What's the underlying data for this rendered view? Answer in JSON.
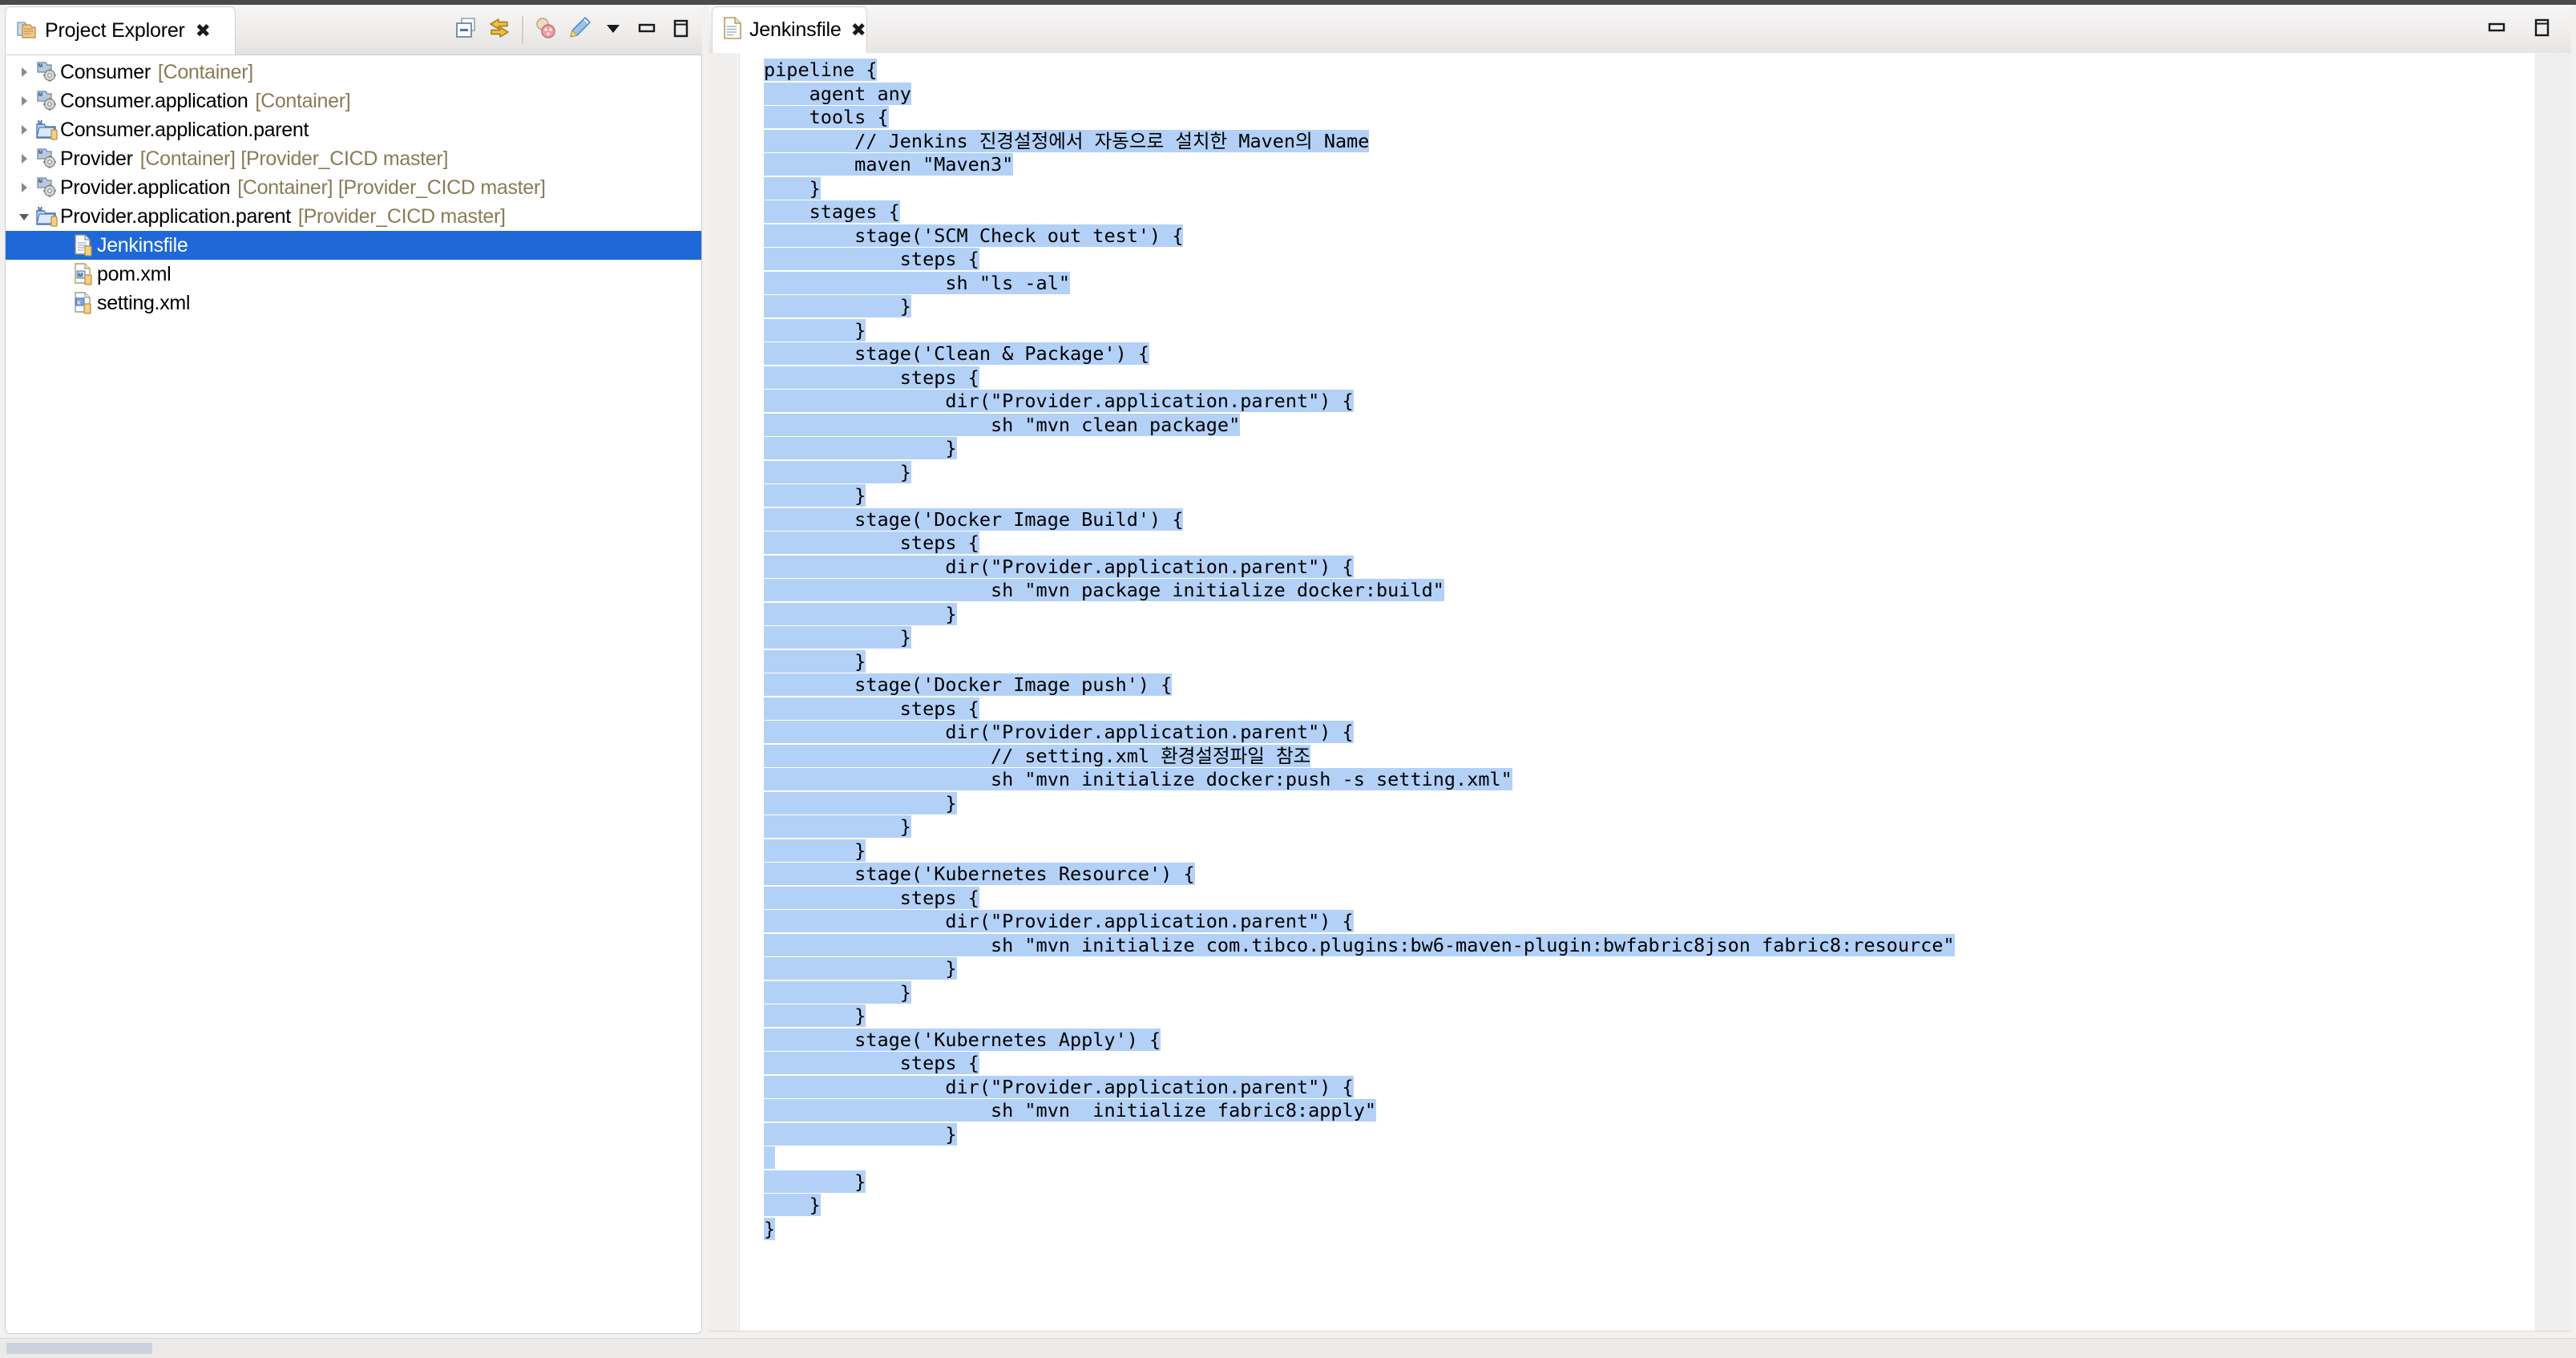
{
  "left_view": {
    "tab": {
      "title": "Project Explorer",
      "close_glyph": "✖",
      "icon": "project-explorer-icon"
    },
    "toolbar": [
      {
        "name": "collapse-all-button",
        "tooltip": "Collapse All"
      },
      {
        "name": "link-with-editor-button",
        "tooltip": "Link with Editor"
      },
      {
        "name": "focus-on-active-task-button",
        "tooltip": "Focus on Active Task"
      },
      {
        "name": "edit-task-button",
        "tooltip": "Edit Task"
      },
      {
        "name": "view-menu-button",
        "tooltip": "View Menu"
      },
      {
        "name": "minimize-button",
        "tooltip": "Minimize"
      },
      {
        "name": "maximize-button",
        "tooltip": "Maximize"
      }
    ],
    "tree": [
      {
        "indent": 1,
        "expander": "collapsed",
        "icon": "maven-project-icon",
        "label": "Consumer",
        "meta": "[Container]",
        "selected": false
      },
      {
        "indent": 1,
        "expander": "collapsed",
        "icon": "maven-project-icon",
        "label": "Consumer.application",
        "meta": "[Container]",
        "selected": false
      },
      {
        "indent": 1,
        "expander": "collapsed",
        "icon": "maven-folder-icon",
        "label": "Consumer.application.parent",
        "meta": "",
        "selected": false
      },
      {
        "indent": 1,
        "expander": "collapsed",
        "icon": "maven-project-icon",
        "label": "Provider",
        "meta": "[Container] [Provider_CICD master]",
        "selected": false
      },
      {
        "indent": 1,
        "expander": "collapsed",
        "icon": "maven-project-icon",
        "label": "Provider.application",
        "meta": "[Container] [Provider_CICD master]",
        "selected": false
      },
      {
        "indent": 1,
        "expander": "expanded",
        "icon": "maven-folder-icon",
        "label": "Provider.application.parent",
        "meta": "[Provider_CICD master]",
        "selected": false
      },
      {
        "indent": 2,
        "expander": "none",
        "icon": "file-text-icon",
        "label": "Jenkinsfile",
        "meta": "",
        "selected": true
      },
      {
        "indent": 2,
        "expander": "none",
        "icon": "pom-xml-icon",
        "label": "pom.xml",
        "meta": "",
        "selected": false
      },
      {
        "indent": 2,
        "expander": "none",
        "icon": "xml-file-icon",
        "label": "setting.xml",
        "meta": "",
        "selected": false
      }
    ]
  },
  "editor": {
    "tab": {
      "title": "Jenkinsfile",
      "close_glyph": "✖",
      "icon": "file-text-icon"
    },
    "window_buttons": [
      {
        "name": "minimize-button",
        "tooltip": "Minimize"
      },
      {
        "name": "maximize-button",
        "tooltip": "Maximize"
      }
    ],
    "selection_color": "#b3d1f7",
    "code": "pipeline {\n    agent any\n    tools {\n        // Jenkins 진경설정에서 자동으로 설치한 Maven의 Name\n        maven \"Maven3\"\n    }\n    stages {\n        stage('SCM Check out test') {\n            steps {\n                sh \"ls -al\"\n            }\n        }\n        stage('Clean & Package') {\n            steps {\n                dir(\"Provider.application.parent\") {\n                    sh \"mvn clean package\"\n                }\n            }\n        }\n        stage('Docker Image Build') {\n            steps {\n                dir(\"Provider.application.parent\") {\n                    sh \"mvn package initialize docker:build\"\n                }\n            }\n        }\n        stage('Docker Image push') {\n            steps {\n                dir(\"Provider.application.parent\") {\n                    // setting.xml 환경설정파일 참조\n                    sh \"mvn initialize docker:push -s setting.xml\"\n                }\n            }\n        }\n        stage('Kubernetes Resource') {\n            steps {\n                dir(\"Provider.application.parent\") {\n                    sh \"mvn initialize com.tibco.plugins:bw6-maven-plugin:bwfabric8json fabric8:resource\"\n                }\n            }\n        }\n        stage('Kubernetes Apply') {\n            steps {\n                dir(\"Provider.application.parent\") {\n                    sh \"mvn  initialize fabric8:apply\"\n                }\n\n        }\n    }\n}"
  }
}
